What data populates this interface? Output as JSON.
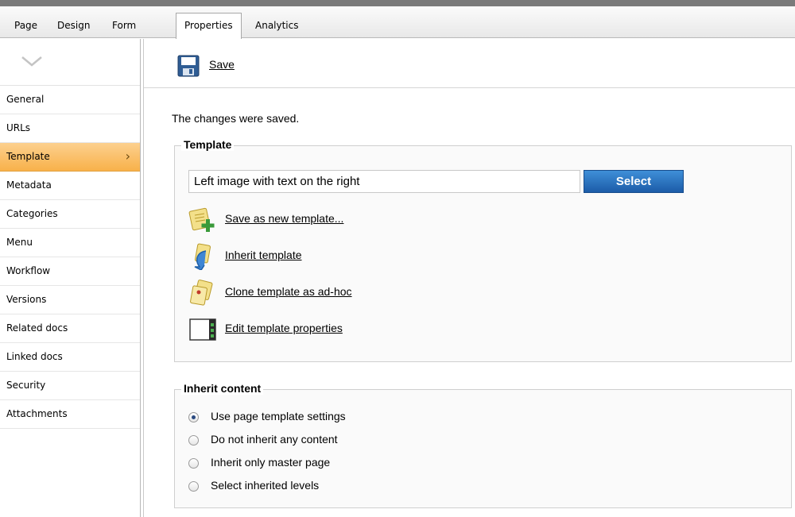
{
  "top_tabs": [
    {
      "label": "Page"
    },
    {
      "label": "Design"
    },
    {
      "label": "Form"
    },
    {
      "label": "Properties",
      "active": true
    },
    {
      "label": "Analytics"
    }
  ],
  "sidebar": {
    "collapse_icon": "chevron-down-icon",
    "items": [
      {
        "label": "General"
      },
      {
        "label": "URLs"
      },
      {
        "label": "Template",
        "active": true
      },
      {
        "label": "Metadata"
      },
      {
        "label": "Categories"
      },
      {
        "label": "Menu"
      },
      {
        "label": "Workflow"
      },
      {
        "label": "Versions"
      },
      {
        "label": "Related docs"
      },
      {
        "label": "Linked docs"
      },
      {
        "label": "Security"
      },
      {
        "label": "Attachments"
      }
    ]
  },
  "toolbar": {
    "save_label": "Save",
    "save_icon": "floppy-disk-icon"
  },
  "status_message": "The changes were saved.",
  "template_section": {
    "title": "Template",
    "current_template": "Left image with text on the right",
    "select_label": "Select",
    "actions": [
      {
        "label": "Save as new template...",
        "icon": "save-template-icon"
      },
      {
        "label": "Inherit template",
        "icon": "inherit-icon"
      },
      {
        "label": "Clone template as ad-hoc",
        "icon": "clone-icon"
      },
      {
        "label": "Edit template properties",
        "icon": "edit-properties-icon"
      }
    ]
  },
  "inherit_section": {
    "title": "Inherit content",
    "options": [
      {
        "label": "Use page template settings",
        "checked": true
      },
      {
        "label": "Do not inherit any content",
        "checked": false
      },
      {
        "label": "Inherit only master page",
        "checked": false
      },
      {
        "label": "Select inherited levels",
        "checked": false
      }
    ]
  },
  "colors": {
    "accent": "#f8b14a",
    "button": "#1c5ca8"
  }
}
